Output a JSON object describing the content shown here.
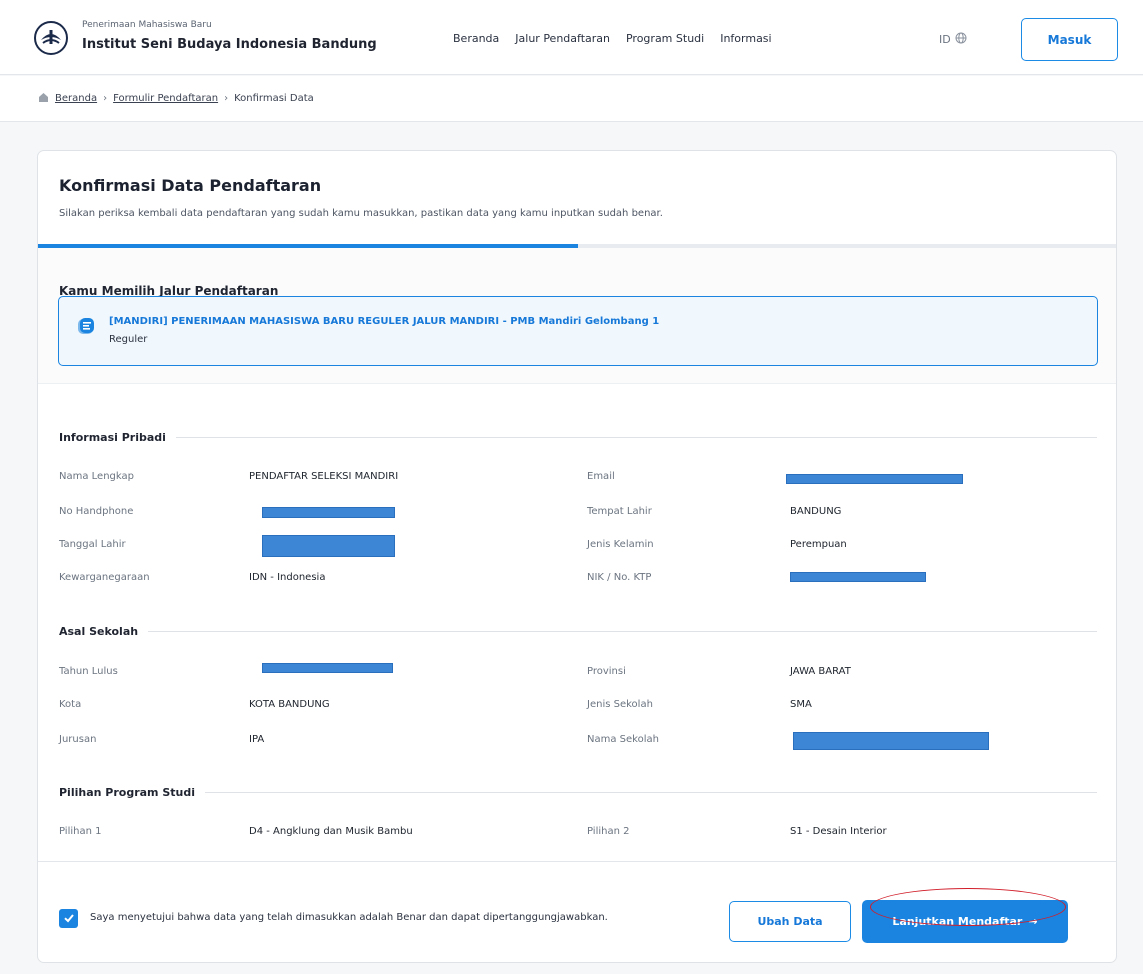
{
  "header": {
    "brand_small": "Penerimaan Mahasiswa Baru",
    "brand_title": "Institut Seni Budaya Indonesia Bandung",
    "nav": [
      "Beranda",
      "Jalur Pendaftaran",
      "Program Studi",
      "Informasi"
    ],
    "lang": "ID",
    "login_label": "Masuk"
  },
  "breadcrumb": {
    "items": [
      "Beranda",
      "Formulir Pendaftaran",
      "Konfirmasi Data"
    ],
    "separator": "›"
  },
  "page": {
    "title": "Konfirmasi Data Pendaftaran",
    "subtitle": "Silakan periksa kembali data pendaftaran yang sudah kamu masukkan, pastikan data yang kamu inputkan sudah benar.",
    "progress_percent": 50
  },
  "jalur": {
    "heading": "Kamu Memilih Jalur Pendaftaran",
    "title": "[MANDIRI] PENERIMAAN MAHASISWA BARU REGULER JALUR MANDIRI - PMB Mandiri Gelombang 1",
    "subtitle": "Reguler"
  },
  "sections": {
    "pribadi": {
      "heading": "Informasi Pribadi",
      "fields": {
        "nama_label": "Nama Lengkap",
        "nama_value": "PENDAFTAR SELEKSI MANDIRI",
        "email_label": "Email",
        "hp_label": "No Handphone",
        "tempat_label": "Tempat Lahir",
        "tempat_value": "BANDUNG",
        "tgl_label": "Tanggal Lahir",
        "jk_label": "Jenis Kelamin",
        "jk_value": "Perempuan",
        "kwn_label": "Kewarganegaraan",
        "kwn_value": "IDN - Indonesia",
        "nik_label": "NIK / No. KTP"
      }
    },
    "sekolah": {
      "heading": "Asal Sekolah",
      "fields": {
        "lulus_label": "Tahun Lulus",
        "provinsi_label": "Provinsi",
        "provinsi_value": "JAWA BARAT",
        "kota_label": "Kota",
        "kota_value": "KOTA BANDUNG",
        "jenis_label": "Jenis Sekolah",
        "jenis_value": "SMA",
        "jurusan_label": "Jurusan",
        "jurusan_value": "IPA",
        "nama_label": "Nama Sekolah"
      }
    },
    "prodi": {
      "heading": "Pilihan Program Studi",
      "fields": {
        "p1_label": "Pilihan 1",
        "p1_value": "D4 - Angklung dan Musik Bambu",
        "p2_label": "Pilihan 2",
        "p2_value": "S1 - Desain Interior"
      }
    }
  },
  "footer": {
    "agreement": "Saya menyetujui bahwa data yang telah dimasukkan adalah Benar dan dapat dipertanggungjawabkan.",
    "agreement_checked": true,
    "edit_label": "Ubah Data",
    "continue_label": "Lanjutkan Mendaftar",
    "continue_arrow": "→"
  },
  "colors": {
    "accent": "#1a84e0",
    "redaction": "#3d86d6",
    "annotation": "#d11e2a"
  }
}
